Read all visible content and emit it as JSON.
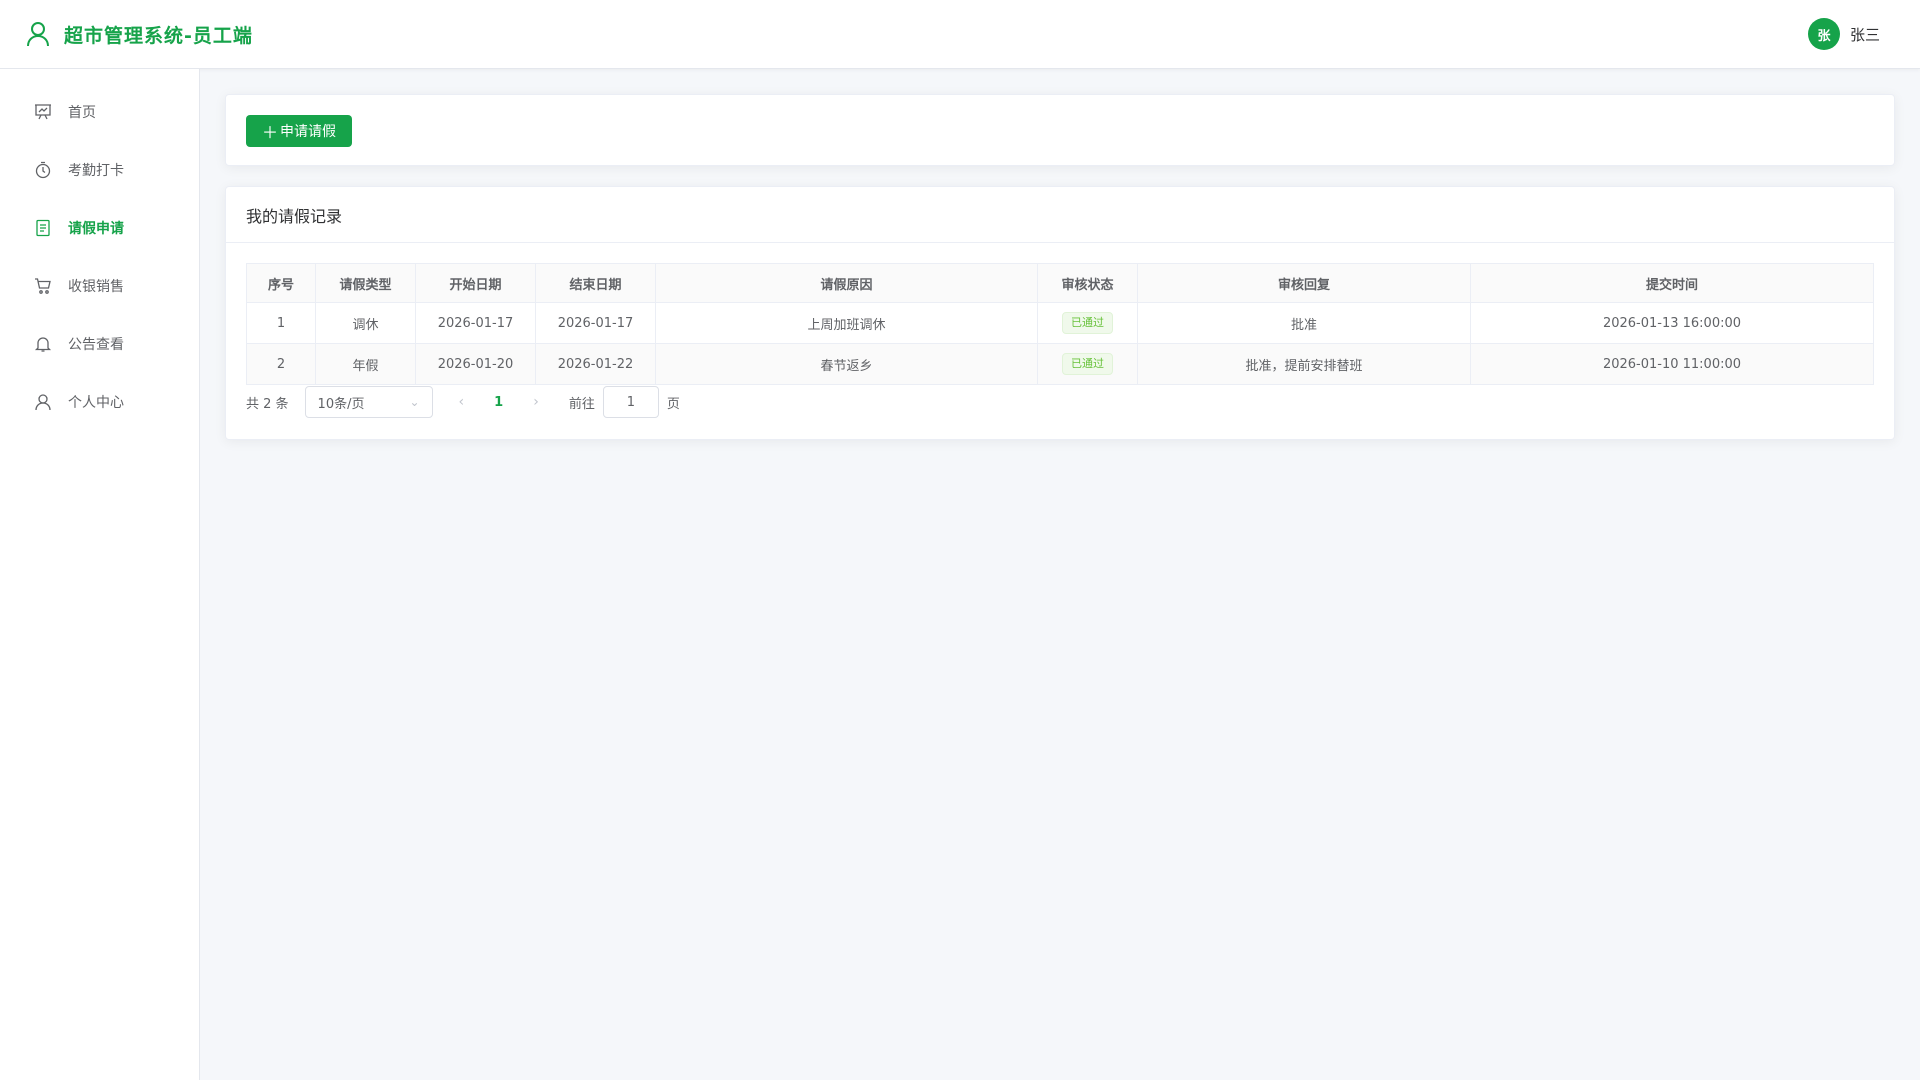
{
  "header": {
    "title": "超市管理系统-员工端",
    "user": {
      "avatar_text": "张",
      "name": "张三"
    }
  },
  "sidebar": {
    "items": [
      {
        "label": "首页",
        "icon": "presentation-icon",
        "active": false
      },
      {
        "label": "考勤打卡",
        "icon": "timer-icon",
        "active": false
      },
      {
        "label": "请假申请",
        "icon": "document-icon",
        "active": true
      },
      {
        "label": "收银销售",
        "icon": "cart-icon",
        "active": false
      },
      {
        "label": "公告查看",
        "icon": "bell-icon",
        "active": false
      },
      {
        "label": "个人中心",
        "icon": "user-icon",
        "active": false
      }
    ]
  },
  "toolbar": {
    "apply_button": "申请请假",
    "apply_icon": "plus-icon"
  },
  "records": {
    "title": "我的请假记录",
    "columns": [
      "序号",
      "请假类型",
      "开始日期",
      "结束日期",
      "请假原因",
      "审核状态",
      "审核回复",
      "提交时间"
    ],
    "rows": [
      [
        "1",
        "调休",
        "2026-01-17",
        "2026-01-17",
        "上周加班调休",
        "已通过",
        "批准",
        "2026-01-13 16:00:00"
      ],
      [
        "2",
        "年假",
        "2026-01-20",
        "2026-01-22",
        "春节返乡",
        "已通过",
        "批准，提前安排替班",
        "2026-01-10 11:00:00"
      ]
    ]
  },
  "pagination": {
    "total": "共 2 条",
    "page_size": "10条/页",
    "current_page": "1",
    "goto_label": "前往",
    "goto_value": "1",
    "page_unit": "页"
  },
  "colors": {
    "accent": "#16a34a",
    "status_success": "#67c23a"
  }
}
